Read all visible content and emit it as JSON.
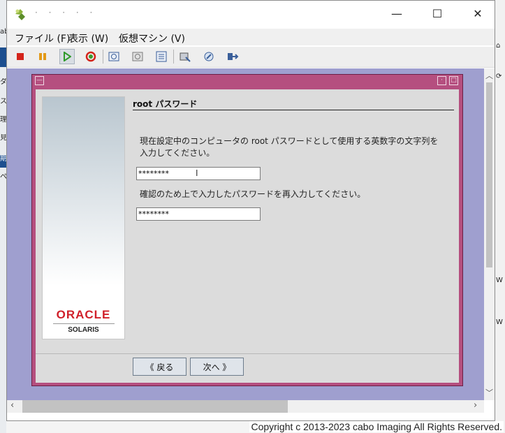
{
  "window": {
    "title": "· · · · ·"
  },
  "title_buttons": {
    "minimize": "—",
    "maximize": "☐",
    "close": "✕"
  },
  "menu": [
    {
      "label": "ファイル (F)"
    },
    {
      "label": "表示 (W)"
    },
    {
      "label": "仮想マシン (V)"
    }
  ],
  "toolbar": {
    "icons": [
      "stop-icon",
      "pause-icon",
      "play-icon",
      "reset-icon",
      "snapshot-icon",
      "restore-snapshot-icon",
      "manage-snapshots-icon",
      "settings-icon",
      "tools-icon",
      "network-icon"
    ]
  },
  "installer": {
    "heading": "root パスワード",
    "instruction_line1": "現在設定中のコンピュータの root パスワードとして使用する英数字の文字列を",
    "instruction_line2": "入力してください。",
    "password_value": "********",
    "confirm_label": "確認のため上で入力したパスワードを再入力してください。",
    "confirm_value": "********",
    "logo_brand": "ORACLE",
    "logo_product": "SOLARIS",
    "back_button": "《 戻る",
    "next_button": "次へ 》"
  },
  "background": {
    "copyright": "Copyright c 2013-2023 cabo Imaging All Rights Reserved."
  },
  "colors": {
    "dialog_frame": "#b54f7f",
    "screen_bg": "#9f9fcf",
    "dialog_body": "#dcdcdc"
  }
}
